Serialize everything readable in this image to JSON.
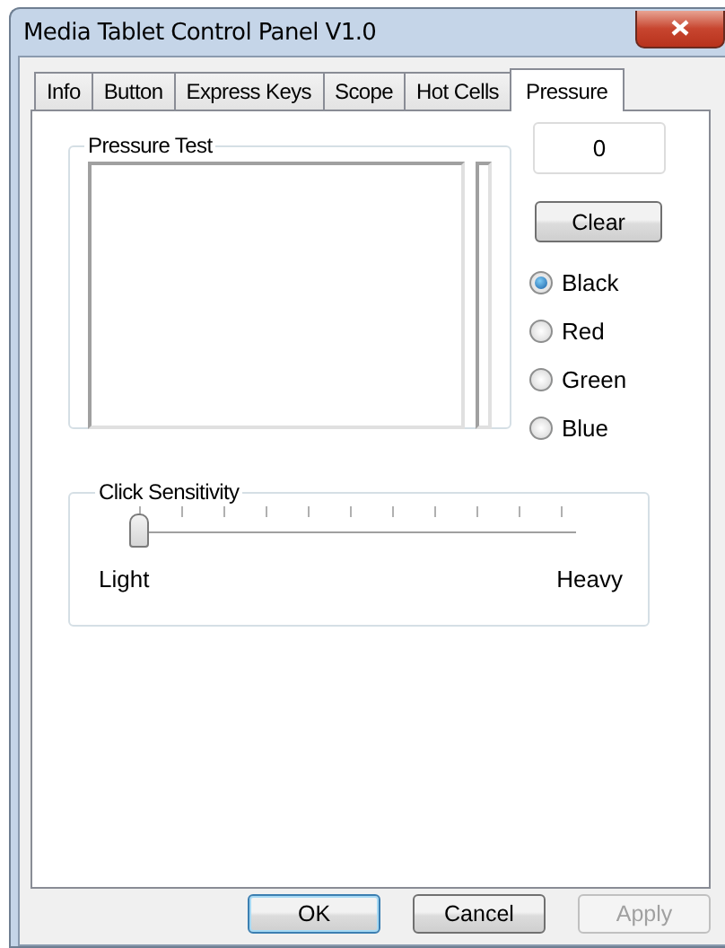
{
  "window": {
    "title": "Media Tablet Control Panel V1.0"
  },
  "tabs": [
    {
      "label": "Info",
      "selected": false
    },
    {
      "label": "Button",
      "selected": false
    },
    {
      "label": "Express Keys",
      "selected": false
    },
    {
      "label": "Scope",
      "selected": false
    },
    {
      "label": "Hot Cells",
      "selected": false
    },
    {
      "label": "Pressure",
      "selected": true
    }
  ],
  "pressure_test": {
    "title": "Pressure Test",
    "value": "0",
    "clear_button": "Clear",
    "colors": [
      {
        "label": "Black",
        "selected": true
      },
      {
        "label": "Red",
        "selected": false
      },
      {
        "label": "Green",
        "selected": false
      },
      {
        "label": "Blue",
        "selected": false
      }
    ]
  },
  "click_sensitivity": {
    "title": "Click Sensitivity",
    "level": 0,
    "min_label": "Light",
    "max_label": "Heavy"
  },
  "buttons": [
    {
      "label": "OK",
      "kind": "default",
      "disabled": false
    },
    {
      "label": "Cancel",
      "kind": "normal",
      "disabled": false
    },
    {
      "label": "Apply",
      "kind": "normal",
      "disabled": true
    }
  ]
}
